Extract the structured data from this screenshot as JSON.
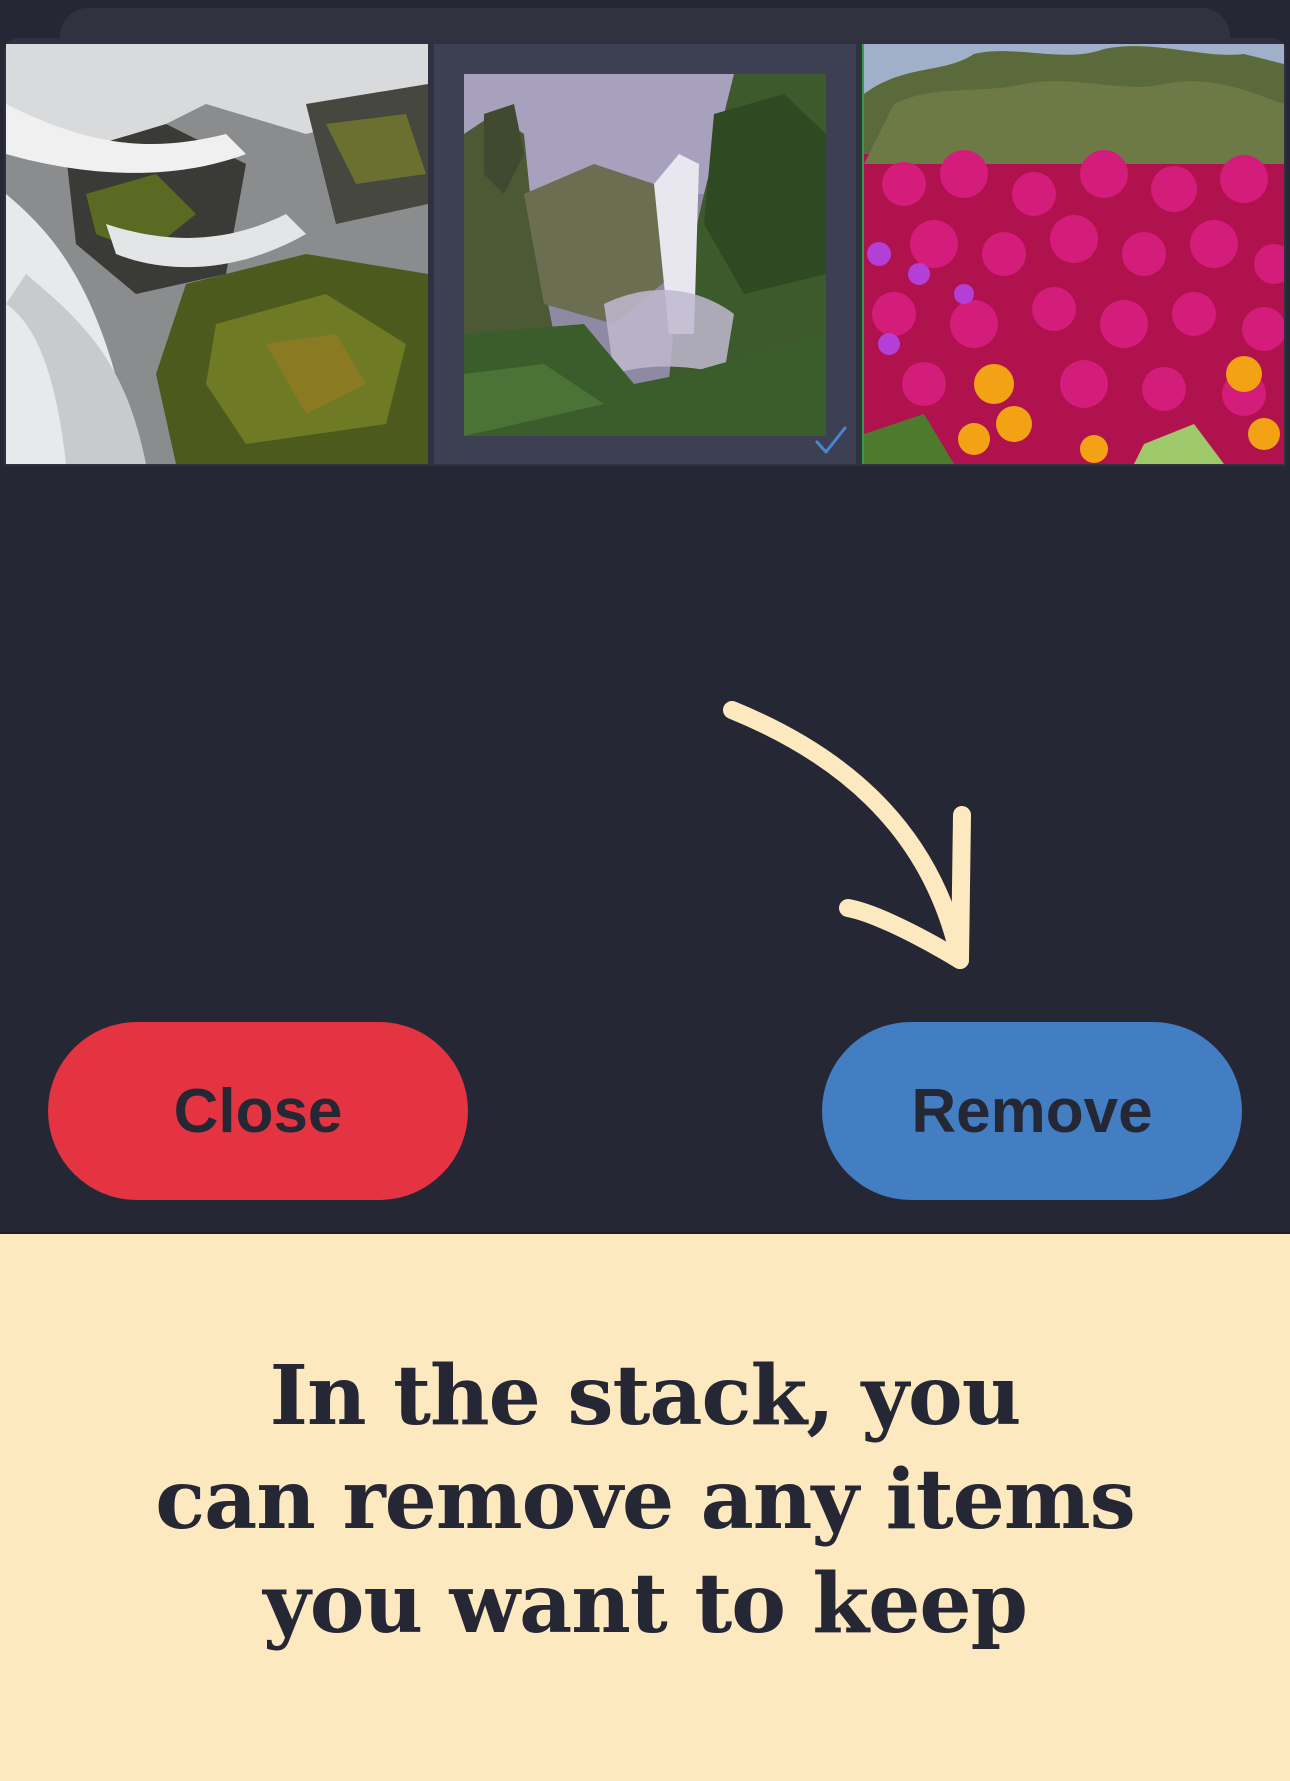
{
  "colors": {
    "background": "#262734",
    "close_button": "#e43442",
    "remove_button": "#437ec2",
    "caption_background": "#fde9c0",
    "arrow": "#fde9c0",
    "check": "#4a86d0"
  },
  "stack": {
    "photos": [
      {
        "icon": "waterfall-rocks-photo",
        "selected": false
      },
      {
        "icon": "waterfall-canyon-photo",
        "selected": true
      },
      {
        "icon": "flowers-photo",
        "selected": false
      }
    ]
  },
  "buttons": {
    "close_label": "Close",
    "remove_label": "Remove"
  },
  "caption": {
    "line1": "In the stack, you",
    "line2": "can remove any items",
    "line3": "you want to keep"
  }
}
